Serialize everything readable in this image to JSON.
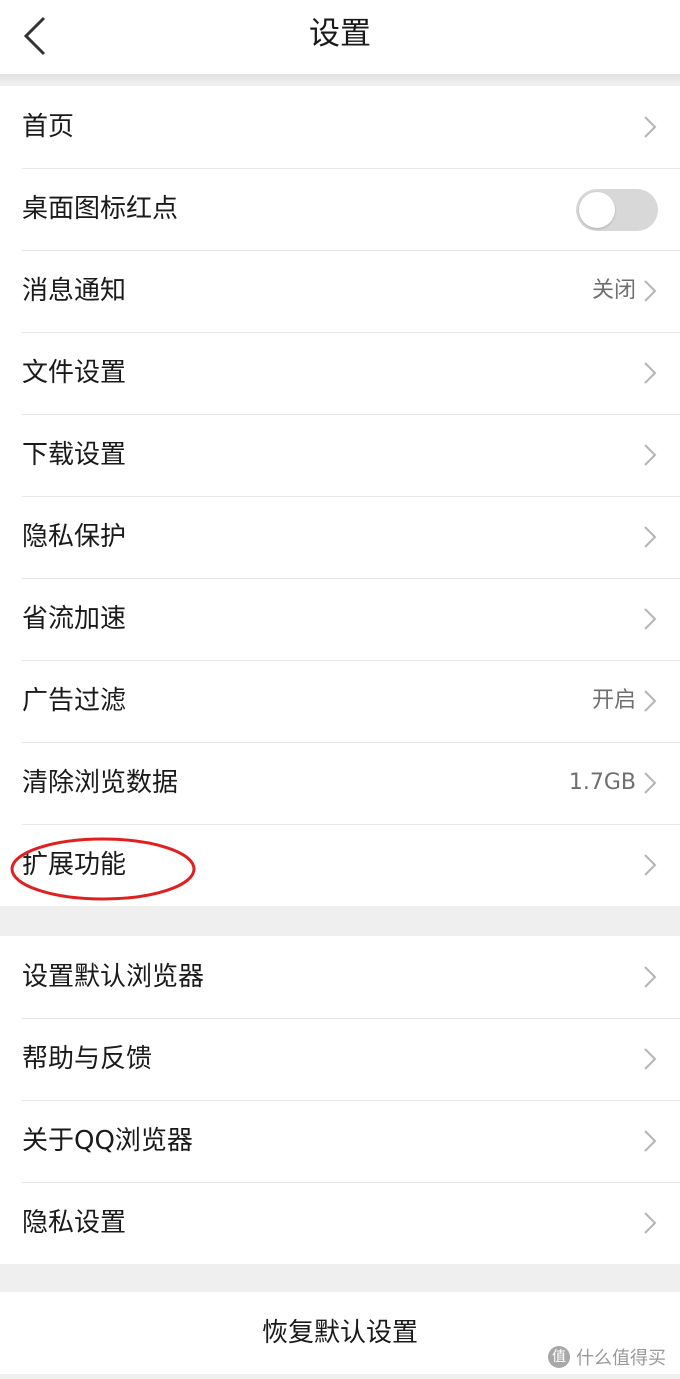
{
  "header": {
    "title": "设置",
    "back_icon": "chevron-left-icon"
  },
  "group1": {
    "items": [
      {
        "label": "首页",
        "value": "",
        "control": "chevron"
      },
      {
        "label": "桌面图标红点",
        "value": "",
        "control": "toggle",
        "toggle_on": false
      },
      {
        "label": "消息通知",
        "value": "关闭",
        "control": "chevron"
      },
      {
        "label": "文件设置",
        "value": "",
        "control": "chevron"
      },
      {
        "label": "下载设置",
        "value": "",
        "control": "chevron"
      },
      {
        "label": "隐私保护",
        "value": "",
        "control": "chevron"
      },
      {
        "label": "省流加速",
        "value": "",
        "control": "chevron"
      },
      {
        "label": "广告过滤",
        "value": "开启",
        "control": "chevron"
      },
      {
        "label": "清除浏览数据",
        "value": "1.7GB",
        "control": "chevron"
      },
      {
        "label": "扩展功能",
        "value": "",
        "control": "chevron",
        "highlighted": true
      }
    ]
  },
  "group2": {
    "items": [
      {
        "label": "设置默认浏览器",
        "value": "",
        "control": "chevron"
      },
      {
        "label": "帮助与反馈",
        "value": "",
        "control": "chevron"
      },
      {
        "label": "关于QQ浏览器",
        "value": "",
        "control": "chevron"
      },
      {
        "label": "隐私设置",
        "value": "",
        "control": "chevron"
      }
    ]
  },
  "reset": {
    "label": "恢复默认设置"
  },
  "watermark": {
    "logo_glyph": "值",
    "text": "什么值得买"
  },
  "colors": {
    "background": "#efefef",
    "highlight_ellipse": "#e0201e",
    "toggle_off": "#d8d8d8",
    "chevron": "#b5b5b5"
  }
}
